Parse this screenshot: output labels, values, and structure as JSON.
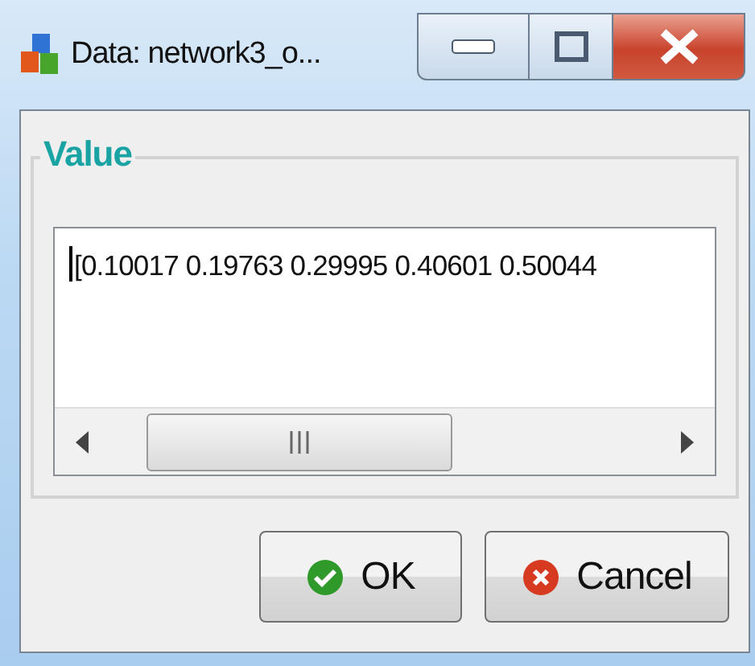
{
  "window": {
    "title": "Data: network3_o..."
  },
  "group": {
    "title": "Value",
    "text": "[0.10017 0.19763 0.29995 0.40601 0.50044"
  },
  "buttons": [
    {
      "kind": "ok",
      "label": "OK"
    },
    {
      "kind": "cancel",
      "label": "Cancel"
    }
  ]
}
